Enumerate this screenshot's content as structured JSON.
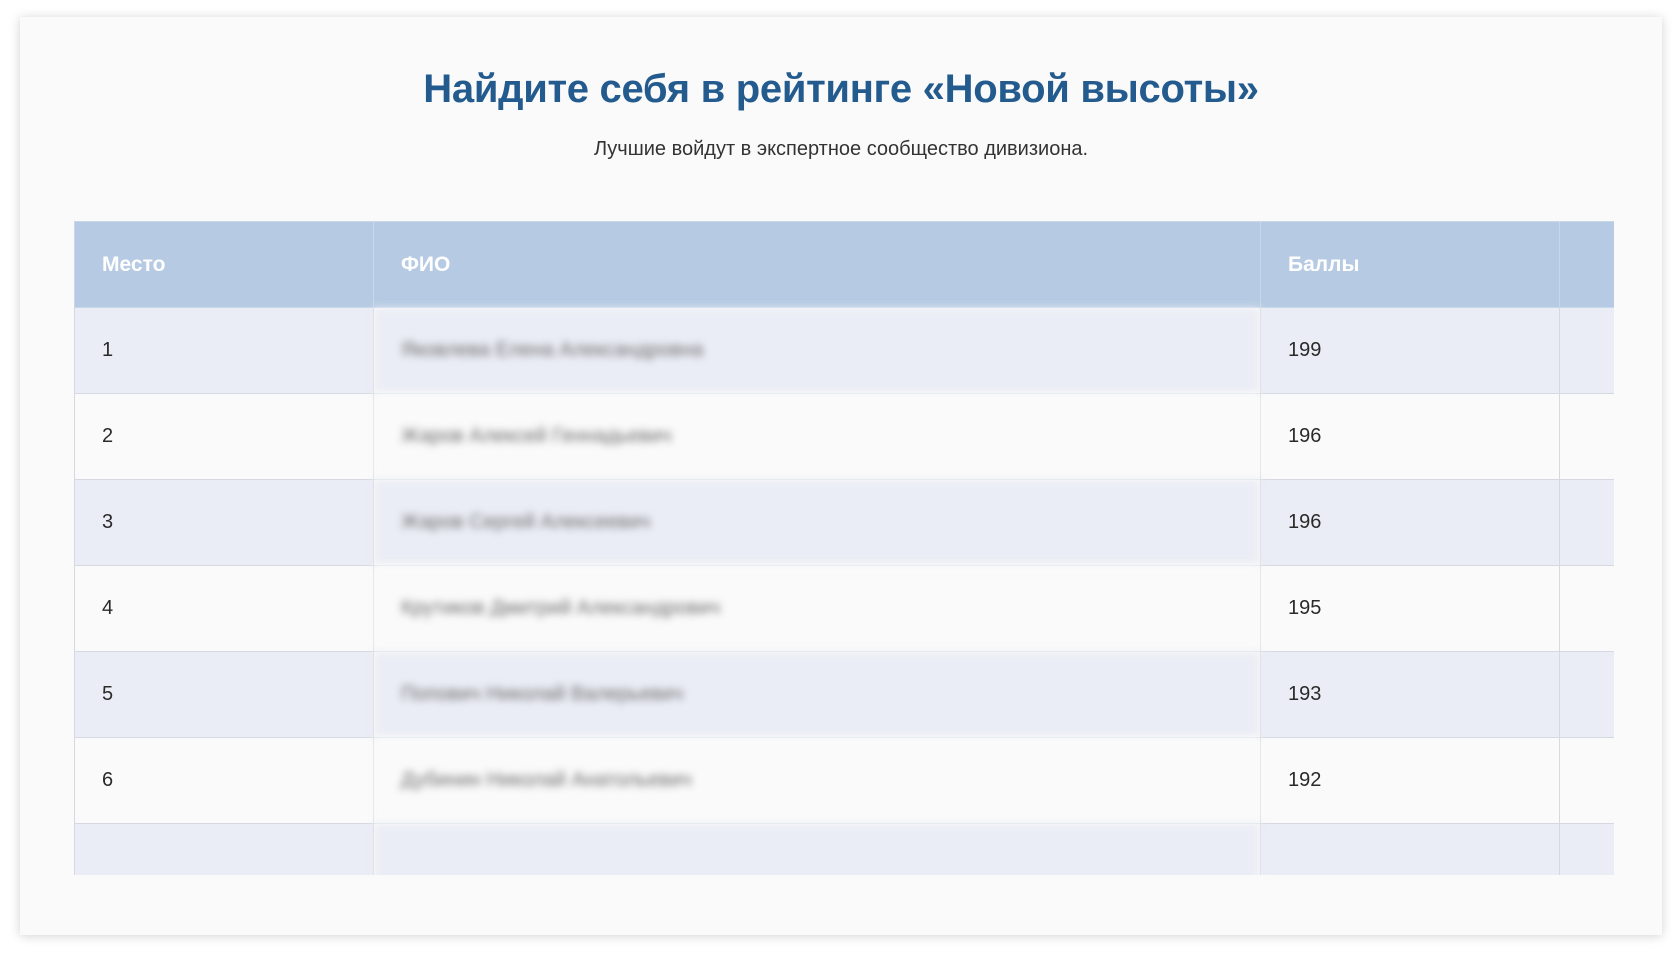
{
  "header": {
    "title": "Найдите себя в рейтинге «Новой высоты»",
    "subtitle": "Лучшие войдут в экспертное сообщество дивизиона."
  },
  "table": {
    "columns": [
      "Место",
      "ФИО",
      "Баллы",
      ""
    ],
    "rows": [
      {
        "place": "1",
        "name": "Яковлева Елена Александровна",
        "score": "199"
      },
      {
        "place": "2",
        "name": "Жаров Алексей Геннадьевич",
        "score": "196"
      },
      {
        "place": "3",
        "name": "Жаров Сергей Алексеевич",
        "score": "196"
      },
      {
        "place": "4",
        "name": "Крутиков Дмитрий Александрович",
        "score": "195"
      },
      {
        "place": "5",
        "name": "Попович Николай Валерьевич",
        "score": "193"
      },
      {
        "place": "6",
        "name": "Дубинин Николай Анатольевич",
        "score": "192"
      },
      {
        "place": "",
        "name": "",
        "score": ""
      }
    ]
  },
  "colors": {
    "title": "#245b8e",
    "header_bg": "#b6cbe3",
    "row_alt_bg": "#eaedf5",
    "card_bg": "#fafafa"
  }
}
